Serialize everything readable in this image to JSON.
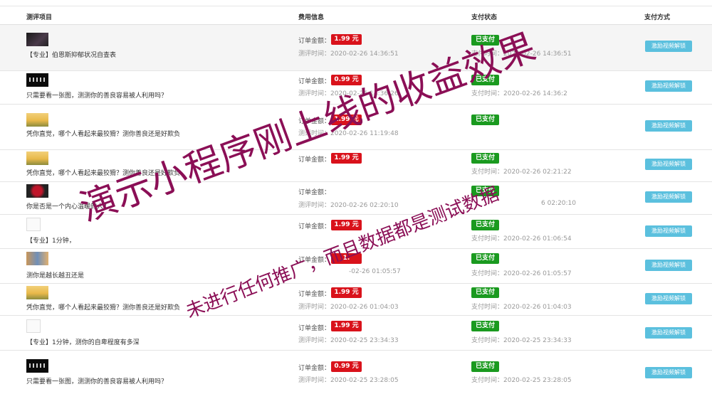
{
  "columns": {
    "item": "测评项目",
    "fee": "费用信息",
    "status": "支付状态",
    "method": "支付方式"
  },
  "labels": {
    "order_amount": "订单金额：",
    "paid": "已支付",
    "unlock": "激励视频解锁"
  },
  "rows": [
    {
      "title": "【专业】伯恩斯抑郁状况自查表",
      "price": "1.99 元",
      "eval_time": "测评时间：2020-02-26 14:36:51",
      "pay_time": "支付时间：2020-02-26 14:36:51",
      "thumb": "dark-portrait"
    },
    {
      "title": "只需要看一张图，测测你的善良容易被人利用吗？",
      "price": "0.99 元",
      "eval_time": "测评时间：2020-02-26 14:36:26",
      "pay_time": "支付时间：2020-02-26 14:36:2",
      "thumb": "black-silhouettes"
    },
    {
      "title": "凭你直觉，哪个人看起来最狡猾？测你善良还是好欺负",
      "price": "1.99 元",
      "eval_time": "测评时间：2020-02-26 11:19:48",
      "pay_time": "",
      "thumb": "wheat-field"
    },
    {
      "title": "凭你直觉，哪个人看起来最狡猾？测你善良还是好欺负",
      "price": "1.99 元",
      "eval_time": "",
      "pay_time": "支付时间：2020-02-26 02:21:22",
      "thumb": "wheat-field"
    },
    {
      "title": "你是否是一个内心温暖的人？",
      "price": "",
      "eval_time": "测评时间：2020-02-26 02:20:10",
      "pay_time": "6 02:20:10",
      "thumb": "rose"
    },
    {
      "title": "【专业】1分钟，",
      "price": "1.99 元",
      "eval_time": "",
      "pay_time": "支付时间：2020-02-26 01:06:54",
      "thumb": "sketch"
    },
    {
      "title": "测你是越长越丑还是",
      "price": "1.",
      "eval_time": "-02-26 01:05:57",
      "pay_time": "支付时间：2020-02-26 01:05:57",
      "thumb": "colorful"
    },
    {
      "title": "凭你直觉，哪个人看起来最狡猾？测你善良还是好欺负",
      "price": "1.99 元",
      "eval_time": "测评时间：2020-02-26 01:04:03",
      "pay_time": "支付时间：2020-02-26 01:04:03",
      "thumb": "wheat-field"
    },
    {
      "title": "【专业】1分钟，测你的自卑程度有多深",
      "price": "1.99 元",
      "eval_time": "测评时间：2020-02-25 23:34:33",
      "pay_time": "支付时间：2020-02-25 23:34:33",
      "thumb": "sketch"
    },
    {
      "title": "只需要看一张图，测测你的善良容易被人利用吗？",
      "price": "0.99 元",
      "eval_time": "测评时间：2020-02-25 23:28:05",
      "pay_time": "支付时间：2020-02-25 23:28:05",
      "thumb": "black-silhouettes"
    }
  ],
  "watermark": {
    "main": "演示小程序刚上线的收益效果",
    "sub": "未进行任何推广，而且数据都是测试数据"
  },
  "colors": {
    "price_badge": "#d9121b",
    "paid_badge": "#1a9a1f",
    "unlock_button": "#5bc0de",
    "watermark": "#8b0f56"
  }
}
